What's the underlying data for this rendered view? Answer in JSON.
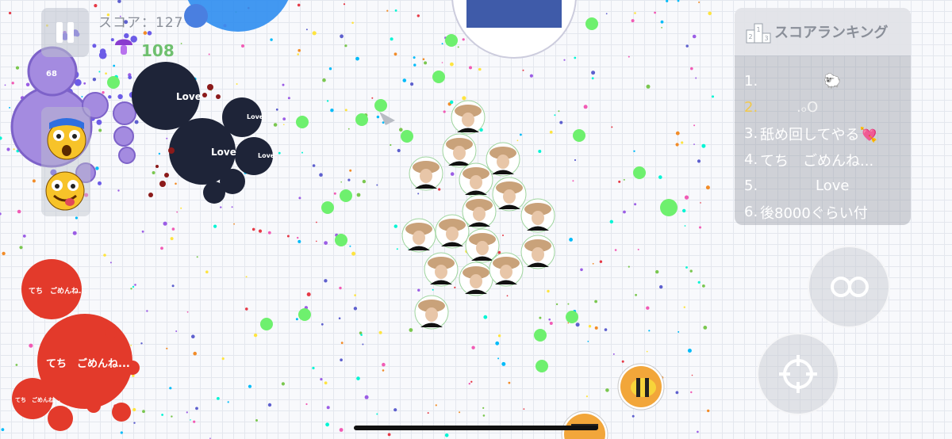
{
  "hud": {
    "score_text": "スコア：127",
    "mushroom_count": "108",
    "pause_icon": "pause-icon"
  },
  "ranking": {
    "title": "スコアランキング",
    "icon": "podium-icon",
    "rows": [
      {
        "num": "1.",
        "name": "🐑"
      },
      {
        "num": "2.",
        "name": ".ₒO"
      },
      {
        "num": "3.",
        "name": "舐め回してやる💘"
      },
      {
        "num": "4.",
        "name": "てち　ごめんね..."
      },
      {
        "num": "5.",
        "name": "Love"
      },
      {
        "num": "6.",
        "name": "後8000ぐらい付"
      }
    ]
  },
  "cells": {
    "dark_cluster_label": "Love",
    "red_cluster_label": "てち　ごめんね...",
    "purple_cluster_label": "68"
  },
  "controls": {
    "split_icon": "split-icon",
    "target_icon": "crosshair-icon"
  },
  "emotes": [
    "shocked-emoji-icon",
    "tongue-emoji-icon"
  ],
  "colors": {
    "dark_cell": "#1e2438",
    "red_cell": "#e33a2b",
    "purple_cell": "#a48be0",
    "green_food": "#6ef06e",
    "blue_cell": "#2b6ed8",
    "rank_me": "#f2c94c"
  }
}
